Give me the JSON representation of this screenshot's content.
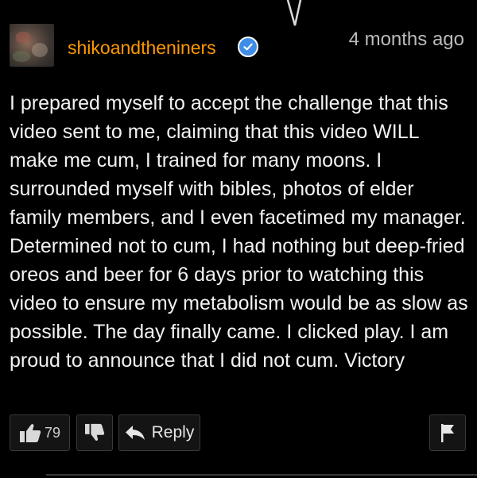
{
  "comment": {
    "author": "shikoandtheniners",
    "verified": true,
    "timestamp": "4 months ago",
    "text": "I prepared myself to accept the challenge that this video sent to me, claiming that this video WILL make me cum, I trained for many moons. I surrounded myself with bibles, photos of elder family members, and I even facetimed my manager. Determined not to cum, I had nothing but deep-fried oreos and beer for 6 days prior to watching this video to ensure my metabolism would be as slow as possible. The day finally came. I clicked play. I am proud to announce that I did not cum. Victory"
  },
  "actions": {
    "like_count": "79",
    "reply_label": "Reply"
  },
  "icons": {
    "like": "thumbs-up-icon",
    "dislike": "thumbs-down-icon",
    "reply": "reply-arrow-icon",
    "flag": "flag-icon",
    "verified": "verified-check-icon"
  },
  "colors": {
    "background": "#000000",
    "author": "#ff9900",
    "verified_badge": "#3f8de6",
    "text": "#f2f2f2",
    "muted": "#bbbbbb",
    "button_bg": "#141414",
    "button_border": "#3a3a3a"
  }
}
